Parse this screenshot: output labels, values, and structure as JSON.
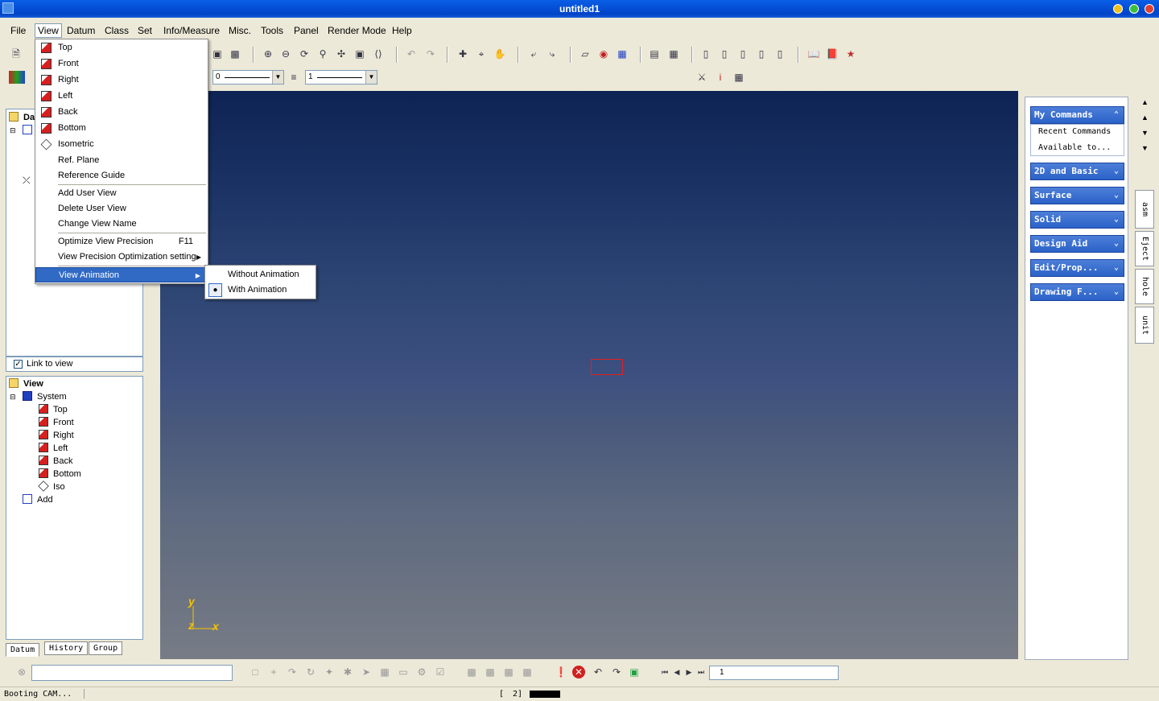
{
  "window": {
    "title": "untitled1"
  },
  "menubar": [
    "File",
    "View",
    "Datum",
    "Class",
    "Set",
    "Info/Measure",
    "Misc.",
    "Tools",
    "Panel",
    "Render Mode",
    "Help"
  ],
  "toolbar": {
    "line_style_value": "0",
    "line_width_value": "1"
  },
  "view_menu": {
    "views": [
      "Top",
      "Front",
      "Right",
      "Left",
      "Back",
      "Bottom",
      "Isometric"
    ],
    "ref_plane": "Ref. Plane",
    "reference_guide": "Reference Guide",
    "user_view_items": [
      "Add User View",
      "Delete User View",
      "Change View Name"
    ],
    "optimize_precision": "Optimize View Precision",
    "optimize_shortcut": "F11",
    "precision_setting": "View Precision Optimization setting",
    "view_animation": "View Animation"
  },
  "animation_submenu": {
    "items": [
      "Without Animation",
      "With Animation"
    ],
    "selected": "With Animation"
  },
  "datum_panel": {
    "header_partial": "Da",
    "link_to_view": "Link to view",
    "link_checked": true
  },
  "view_panel": {
    "header": "View",
    "system": "System",
    "items": [
      "Top",
      "Front",
      "Right",
      "Left",
      "Back",
      "Bottom",
      "Iso"
    ],
    "add": "Add"
  },
  "bottom_tabs": [
    "Datum",
    "History",
    "Group"
  ],
  "axes": {
    "y": "y",
    "z": "z",
    "x": "x"
  },
  "commands_panel": {
    "my_commands": "My Commands",
    "sub_items": [
      "Recent Commands",
      "Available to..."
    ],
    "groups": [
      "2D and Basic",
      "Surface",
      "Solid",
      "Design Aid",
      "Edit/Prop...",
      "Drawing F..."
    ]
  },
  "side_tabs": [
    "asm",
    "Eject",
    "hole",
    "unit"
  ],
  "bottom_toolbar": {
    "page_value": "1"
  },
  "status": {
    "message": "Booting CAM...",
    "coord": "2]"
  },
  "colors": {
    "viewport_top": "#0d2353",
    "viewport_bottom": "#777c86",
    "highlight": "#316ac5",
    "command_header": "#2b62c8"
  }
}
